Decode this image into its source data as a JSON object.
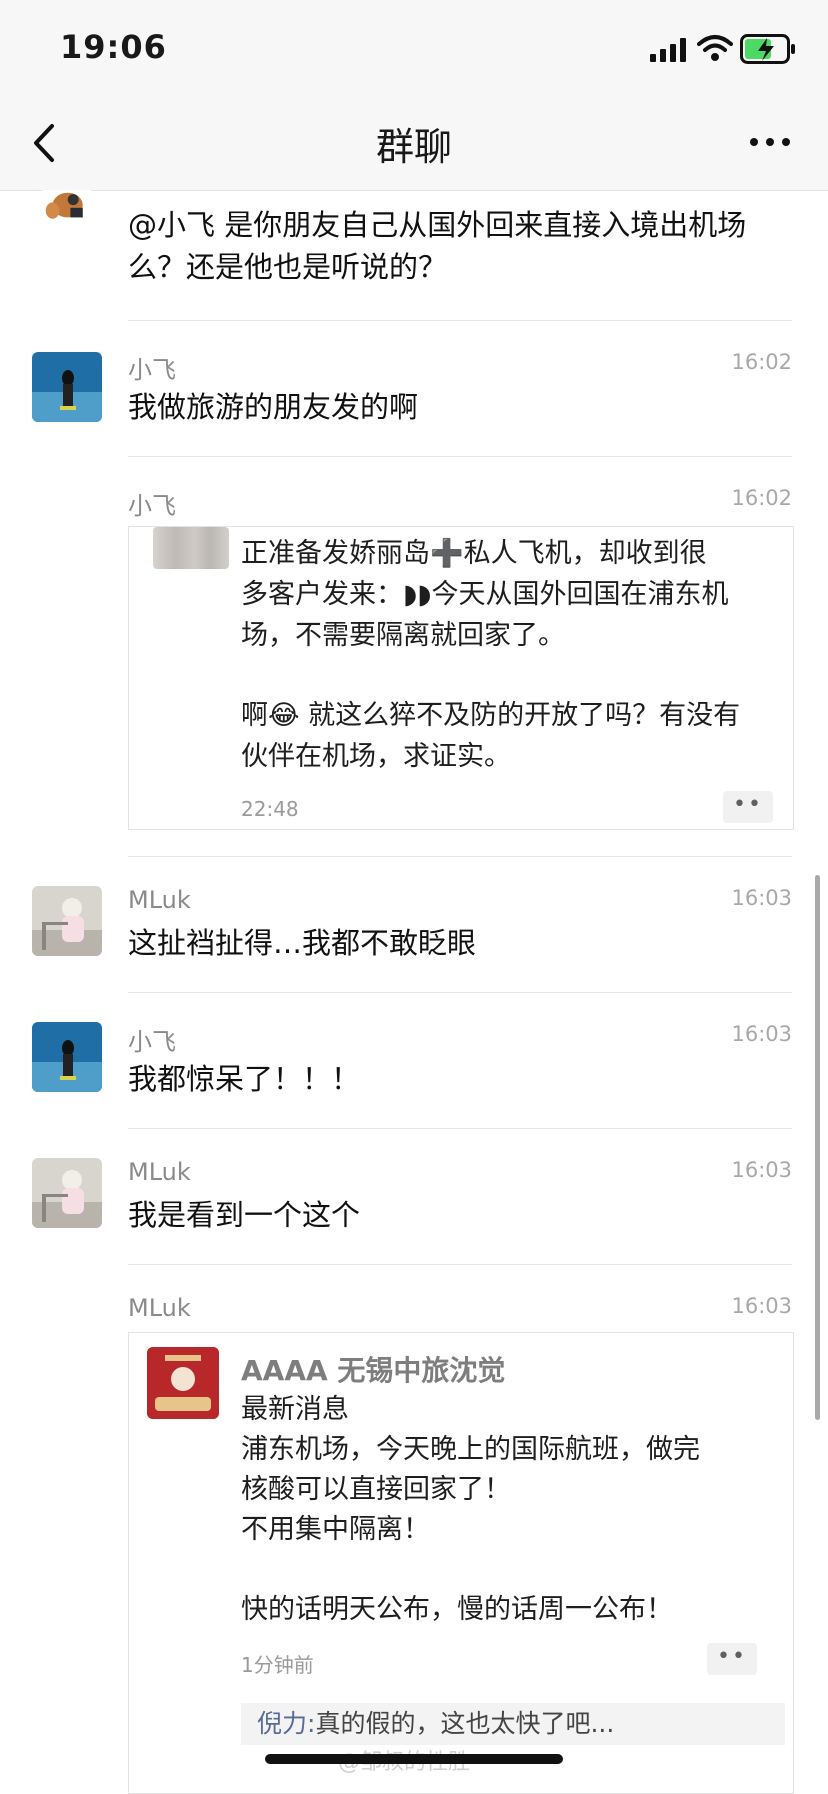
{
  "status_bar": {
    "time": "19:06"
  },
  "nav": {
    "title": "群聊"
  },
  "messages": [
    {
      "text": "@小飞 是你朋友自己从国外回来直接入境出机场么？还是他也是听说的？"
    },
    {
      "sender": "小飞",
      "time": "16:02",
      "text": "我做旅游的朋友发的啊"
    },
    {
      "sender": "小飞",
      "time": "16:02",
      "card": {
        "lines": [
          "正准备发娇丽岛➕私人飞机，却收到很",
          "多客户发来：◗◗今天从国外回国在浦东机",
          "场，不需要隔离就回家了。",
          "",
          "啊😂 就这么猝不及防的开放了吗？有没有",
          "伙伴在机场，求证实。"
        ],
        "time": "22:48",
        "more": "••"
      }
    },
    {
      "sender": "MLuk",
      "time": "16:03",
      "text": "这扯裆扯得…我都不敢眨眼"
    },
    {
      "sender": "小飞",
      "time": "16:03",
      "text": "我都惊呆了！！！"
    },
    {
      "sender": "MLuk",
      "time": "16:03",
      "text": "我是看到一个这个"
    },
    {
      "sender": "MLuk",
      "time": "16:03",
      "card": {
        "poster": "AAAA 无锡中旅沈觉",
        "lines": [
          "最新消息",
          "浦东机场，今天晚上的国际航班，做完",
          "核酸可以直接回家了！",
          "不用集中隔离！",
          "",
          "快的话明天公布，慢的话周一公布！"
        ],
        "time": "1分钟前",
        "more": "••",
        "comment": {
          "author": "倪力:",
          "text": "真的假的，这也太快了吧..."
        }
      }
    }
  ],
  "watermark": "@邹叔的性胜",
  "colors": {
    "bar_bg": "#f7f7f7",
    "link_blue": "#576b95",
    "red_avatar": "#b8282a"
  }
}
